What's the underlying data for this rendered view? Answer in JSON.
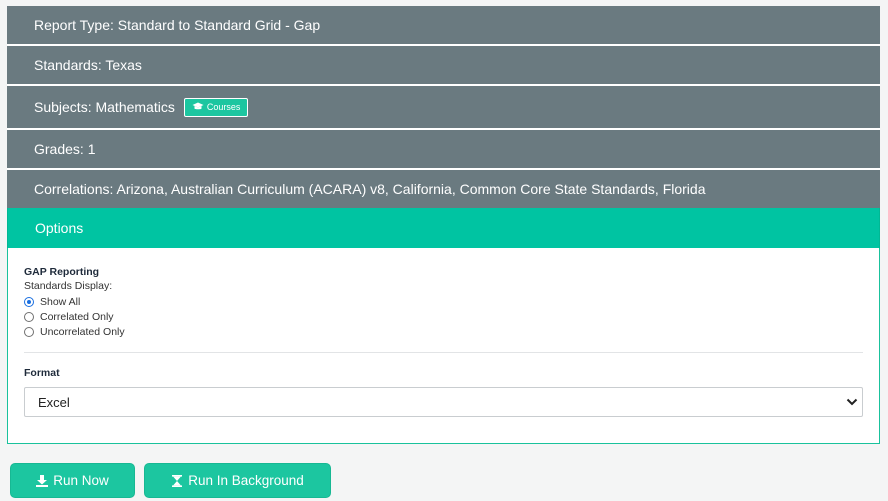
{
  "header": {
    "report_type": "Report Type: Standard to Standard Grid - Gap",
    "standards": "Standards: Texas",
    "subjects": "Subjects: Mathematics",
    "courses_badge": "Courses",
    "grades": "Grades: 1",
    "correlations": "Correlations: Arizona, Australian Curriculum (ACARA) v8, California, Common Core State Standards, Florida"
  },
  "options": {
    "title": "Options",
    "gap": {
      "title": "GAP Reporting",
      "standards_display_label": "Standards Display:",
      "radios": [
        {
          "label": "Show All",
          "checked": true
        },
        {
          "label": "Correlated Only",
          "checked": false
        },
        {
          "label": "Uncorrelated Only",
          "checked": false
        }
      ]
    },
    "format": {
      "title": "Format",
      "selected": "Excel"
    }
  },
  "actions": {
    "run_now": "Run Now",
    "run_background": "Run In Background"
  },
  "colors": {
    "header_row": "#6a7a80",
    "accent": "#00c4a2",
    "button": "#1cc6a0"
  }
}
